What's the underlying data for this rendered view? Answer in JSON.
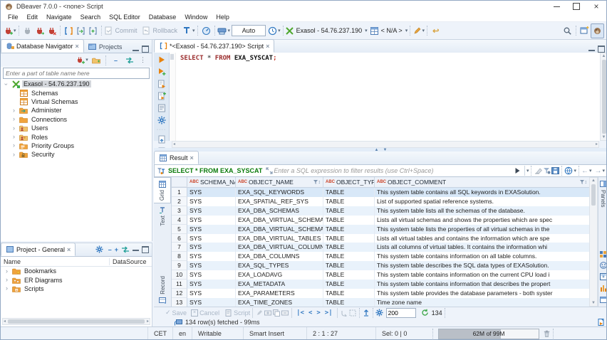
{
  "window": {
    "title": "DBeaver 7.0.0 - <none> Script"
  },
  "menu": {
    "items": [
      "File",
      "Edit",
      "Navigate",
      "Search",
      "SQL Editor",
      "Database",
      "Window",
      "Help"
    ]
  },
  "toolbar": {
    "commit": "Commit",
    "rollback": "Rollback",
    "auto": "Auto",
    "connection": "Exasol - 54.76.237.190",
    "database": "< N/A >"
  },
  "navigator": {
    "tab": "Database Navigator",
    "tab_projects": "Projects",
    "filter_placeholder": "Enter a part of table name here",
    "tree": {
      "root": "Exasol - 54.76.237.190",
      "items": [
        "Schemas",
        "Virtual Schemas",
        "Administer",
        "Connections",
        "Users",
        "Roles",
        "Priority Groups",
        "Security"
      ]
    }
  },
  "project": {
    "tab": "Project - General",
    "col_name": "Name",
    "col_datasource": "DataSource",
    "items": [
      "Bookmarks",
      "ER Diagrams",
      "Scripts"
    ]
  },
  "editor": {
    "tab": "*<Exasol - 54.76.237.190> Script",
    "sql": {
      "select": "SELECT",
      "star": "*",
      "from": "FROM",
      "table": "EXA_SYSCAT",
      "semi": ";"
    }
  },
  "result": {
    "tab": "Result",
    "query": "SELECT * FROM EXA_SYSCAT",
    "filter_placeholder": "Enter a SQL expression to filter results (use Ctrl+Space)",
    "side_tabs": {
      "grid": "Grid",
      "text": "Text",
      "record": "Record"
    },
    "panels": "Panels",
    "columns": {
      "prefix": "ABC",
      "schema": "SCHEMA_NAME",
      "object": "OBJECT_NAME",
      "type": "OBJECT_TYPE",
      "comment": "OBJECT_COMMENT"
    },
    "rows": [
      {
        "schema": "SYS",
        "object": "EXA_SQL_KEYWORDS",
        "type": "TABLE",
        "comment": "This system table contains all SQL keywords in EXASolution."
      },
      {
        "schema": "SYS",
        "object": "EXA_SPATIAL_REF_SYS",
        "type": "TABLE",
        "comment": "List of supported spatial reference systems."
      },
      {
        "schema": "SYS",
        "object": "EXA_DBA_SCHEMAS",
        "type": "TABLE",
        "comment": "This system table lists all the schemas of the database."
      },
      {
        "schema": "SYS",
        "object": "EXA_DBA_VIRTUAL_SCHEMAS",
        "type": "TABLE",
        "comment": "Lists all virtual schemas and shows the properties which are spec"
      },
      {
        "schema": "SYS",
        "object": "EXA_DBA_VIRTUAL_SCHEMA_PROPERTIES",
        "type": "TABLE",
        "comment": "This system table lists the properties of all virtual schemas in the"
      },
      {
        "schema": "SYS",
        "object": "EXA_DBA_VIRTUAL_TABLES",
        "type": "TABLE",
        "comment": "Lists all virtual tables and contains the information which are spe"
      },
      {
        "schema": "SYS",
        "object": "EXA_DBA_VIRTUAL_COLUMNS",
        "type": "TABLE",
        "comment": "Lists all columns of virtual tables. It contains the information whi"
      },
      {
        "schema": "SYS",
        "object": "EXA_DBA_COLUMNS",
        "type": "TABLE",
        "comment": "This system table contains information on all table columns."
      },
      {
        "schema": "SYS",
        "object": "EXA_SQL_TYPES",
        "type": "TABLE",
        "comment": "This system table describes the SQL data types of EXASolution."
      },
      {
        "schema": "SYS",
        "object": "EXA_LOADAVG",
        "type": "TABLE",
        "comment": "This system table contains information on the current CPU load i"
      },
      {
        "schema": "SYS",
        "object": "EXA_METADATA",
        "type": "TABLE",
        "comment": "This system table contains information that describes the propert"
      },
      {
        "schema": "SYS",
        "object": "EXA_PARAMETERS",
        "type": "TABLE",
        "comment": "This system table provides the database parameters - both syster"
      },
      {
        "schema": "SYS",
        "object": "EXA_TIME_ZONES",
        "type": "TABLE",
        "comment": "Time zone name"
      }
    ],
    "toolbar": {
      "save": "Save",
      "cancel": "Cancel",
      "script": "Script",
      "fetch_size": "200",
      "total": "134"
    },
    "status": "134 row(s) fetched - 99ms"
  },
  "statusbar": {
    "tz": "CET",
    "lang": "en",
    "writable": "Writable",
    "insert": "Smart Insert",
    "caret": "2 : 1 : 27",
    "sel": "Sel: 0 | 0",
    "memory": "62M of 99M"
  },
  "glyphs": {
    "dropdown": "▾",
    "close": "×",
    "chevron": "›",
    "min": "–",
    "up": "▲",
    "down": "▼",
    "left": "◂",
    "right": "▸",
    "menu": "⋮",
    "back": "↩",
    "sort": "↕",
    "nav_first": "|<",
    "nav_prev": "<",
    "nav_next": ">",
    "nav_last": ">|",
    "hist_back": "←",
    "hist_fwd": "→",
    "check": "✓",
    "dots": "····"
  }
}
